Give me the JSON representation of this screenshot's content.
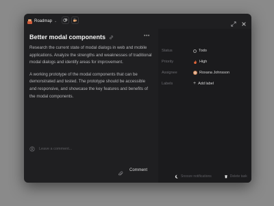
{
  "header": {
    "project": "Roadmap",
    "project_icon": "project-icon",
    "actions": [
      "subscribe-icon",
      "coffee-icon"
    ],
    "window_actions": [
      "expand-icon",
      "close-icon"
    ]
  },
  "issue": {
    "title": "Better modal components",
    "description": [
      "Research the current state of modal dialogs in web and mobile applications. Analyze the strengths and weaknesses of traditional modal dialogs and identify areas for improvement.",
      "A working prototype of the modal components that can be demonstrated and tested. The prototype should be accessible and responsive, and showcase the key features and benefits of the modal components."
    ]
  },
  "comment": {
    "placeholder": "Leave a comment...",
    "button": "Comment"
  },
  "properties": {
    "status": {
      "label": "Status",
      "value": "Todo"
    },
    "priority": {
      "label": "Priority",
      "value": "High"
    },
    "assignee": {
      "label": "Assignee",
      "value": "Roxana Johnsson"
    },
    "labels": {
      "label": "Labels",
      "value": "Add label"
    }
  },
  "footer": {
    "notifications": "Snooze notifications",
    "delete": "Delete task"
  },
  "colors": {
    "background": "#8a8a8a",
    "modal": "#1f1f21",
    "sidebar": "#1b1b1d",
    "priority_high": "#e2663a"
  }
}
